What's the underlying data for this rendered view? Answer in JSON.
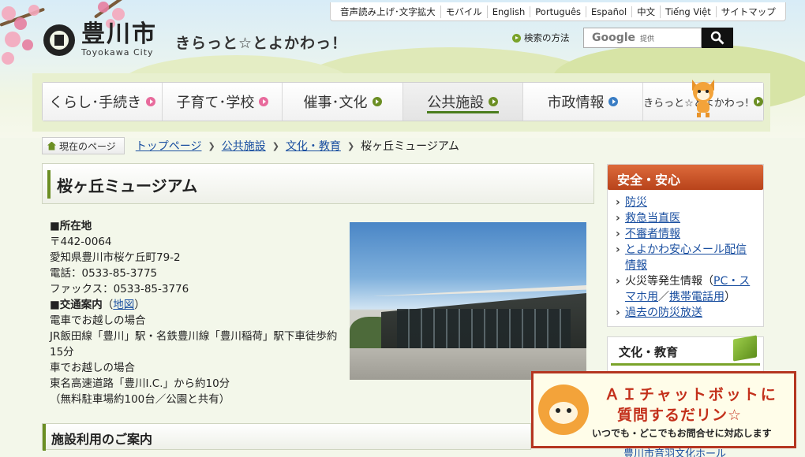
{
  "header": {
    "logo_jp": "豊川市",
    "logo_en": "Toyokawa City",
    "tagline": "きらっと☆とよかわっ！",
    "utility_links": [
      "音声読み上げ･文字拡大",
      "モバイル",
      "English",
      "Português",
      "Español",
      "中文",
      "Tiếng Việt",
      "サイトマップ"
    ],
    "search_how": "検索の方法",
    "search_placeholder_brand": "Google",
    "search_placeholder_sub": "提供"
  },
  "nav": {
    "items": [
      {
        "label": "くらし･手続き",
        "arrow": "pink"
      },
      {
        "label": "子育て･学校",
        "arrow": "pink"
      },
      {
        "label": "催事･文化",
        "arrow": "green"
      },
      {
        "label": "公共施設",
        "arrow": "green"
      },
      {
        "label": "市政情報",
        "arrow": "blue"
      },
      {
        "label": "きらっと☆とよかわっ!",
        "arrow": "green"
      }
    ]
  },
  "breadcrumb": {
    "label": "現在のページ",
    "links": [
      "トップページ",
      "公共施設",
      "文化・教育"
    ],
    "current": "桜ヶ丘ミュージアム"
  },
  "page": {
    "title": "桜ヶ丘ミュージアム",
    "location_heading": "■所在地",
    "postal": "〒442-0064",
    "address": "愛知県豊川市桜ケ丘町79-2",
    "phone": "電話：0533-85-3775",
    "fax": "ファックス：0533-85-3776",
    "access_heading": "■交通案内",
    "access_paren_open": "（",
    "map_link": "地図",
    "access_paren_close": "）",
    "train_heading": "電車でお越しの場合",
    "train_text": "JR飯田線「豊川」駅・名鉄豊川線「豊川稲荷」駅下車徒歩約15分",
    "car_heading": "車でお越しの場合",
    "car_text": "東名高速道路「豊川I.C.」から約10分",
    "parking": "（無料駐車場約100台／公園と共有）",
    "section2_title": "施設利用のご案内"
  },
  "sidebar": {
    "safety_title": "安全・安心",
    "safety_links": [
      "防災",
      "救急当直医",
      "不審者情報",
      "とよかわ安心メール配信情報"
    ],
    "fire_prefix": "火災等発生情報（",
    "fire_link1": "PC・スマホ用",
    "fire_sep": "／",
    "fire_link2": "携帯電話用",
    "fire_suffix": "）",
    "past_link": "過去の防災放送",
    "culture_title": "文化・教育",
    "culture_partial": "豊川市音羽文化ホール"
  },
  "chat": {
    "line1": "ＡＩチャットボットに",
    "line2": "質問するだリン☆",
    "line3": "いつでも・どこでもお問合せに対応します"
  }
}
